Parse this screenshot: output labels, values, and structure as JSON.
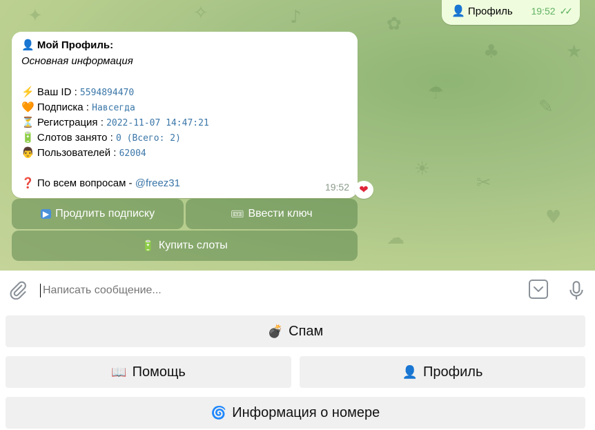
{
  "colors": {
    "outgoing_bubble": "#effdde",
    "check_green": "#61b163",
    "link_blue": "#3a76a8",
    "heart_red": "#e0243a",
    "keyboard_button": "#f0f0f0"
  },
  "outgoing": {
    "icon": "person-icon",
    "icon_glyph": "👤",
    "text": "Профиль",
    "time": "19:52",
    "status_icon": "double-check-icon",
    "status_glyph": "✓✓"
  },
  "profile_message": {
    "title_icon_glyph": "👤",
    "title": "Мой Профиль:",
    "subtitle": "Основная информация",
    "rows": [
      {
        "icon": "lightning-icon",
        "glyph": "⚡",
        "label": "Ваш ID : ",
        "value": "5594894470",
        "extra": ""
      },
      {
        "icon": "orange-heart-icon",
        "glyph": "🧡",
        "label": "Подписка : ",
        "value": "Навсегда",
        "extra": ""
      },
      {
        "icon": "hourglass-icon",
        "glyph": "⏳",
        "label": "Регистрация : ",
        "value": "2022-11-07 14:47:21",
        "extra": ""
      },
      {
        "icon": "battery-icon",
        "glyph": "🔋",
        "label": "Слотов занято : ",
        "value": "0",
        "extra": " (Всего: 2)"
      },
      {
        "icon": "hacker-icon",
        "glyph": "👨",
        "label": "Пользователей : ",
        "value": "62004",
        "extra": ""
      }
    ],
    "question_glyph": "❓",
    "question_label": "По всем вопросам - ",
    "question_link": "@freez31",
    "time": "19:52",
    "reaction_glyph": "❤"
  },
  "inline_buttons": {
    "extend": {
      "glyph": "▶",
      "label": "Продлить подписку"
    },
    "key": {
      "glyph": "🎟",
      "label": "Ввести ключ"
    },
    "buy": {
      "glyph": "🔋",
      "label": "Купить слоты"
    }
  },
  "composer": {
    "placeholder": "Написать сообщение..."
  },
  "reply_keyboard": {
    "spam": {
      "glyph": "💣",
      "label": "Спам"
    },
    "help": {
      "glyph": "📖",
      "label": "Помощь"
    },
    "profile": {
      "glyph": "👤",
      "label": "Профиль"
    },
    "info": {
      "glyph": "🌀",
      "label": "Информация о номере"
    }
  }
}
